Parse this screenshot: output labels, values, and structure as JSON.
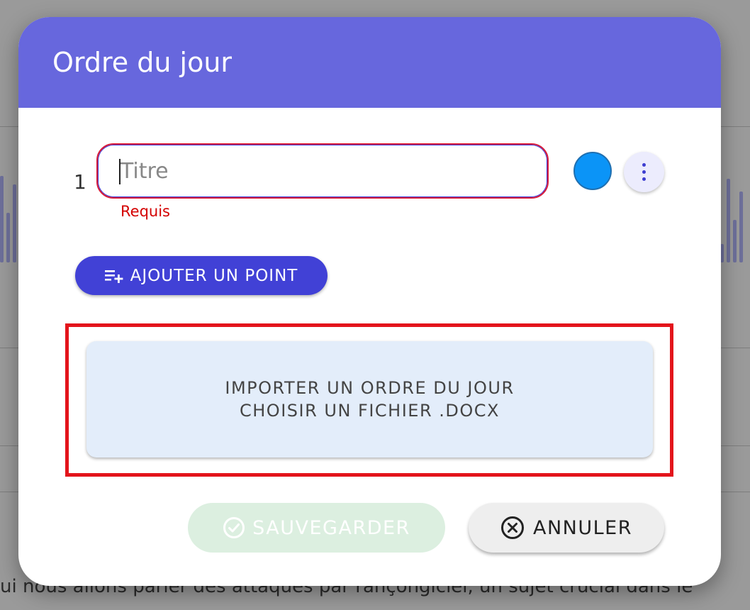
{
  "background": {
    "text": "ui nous allons parler des attaques par rançongiciel, un sujet crucial dans le"
  },
  "dialog": {
    "title": "Ordre du jour",
    "header_color": "#6767dd"
  },
  "item": {
    "number": "1",
    "title_placeholder": "Titre",
    "title_value": "",
    "helper_text": "Requis",
    "color": "#0b94f7",
    "more_icon": "more-vert-icon"
  },
  "add_point_button": {
    "label": "AJOUTER UN POINT",
    "icon": "playlist-add-icon"
  },
  "import_zone": {
    "line1": "IMPORTER UN ORDRE DU JOUR",
    "line2": "CHOISIR UN FICHIER .DOCX"
  },
  "footer": {
    "save_label": "SAUVEGARDER",
    "save_icon": "check-circle-icon",
    "cancel_label": "ANNULER",
    "cancel_icon": "cancel-circle-icon"
  }
}
